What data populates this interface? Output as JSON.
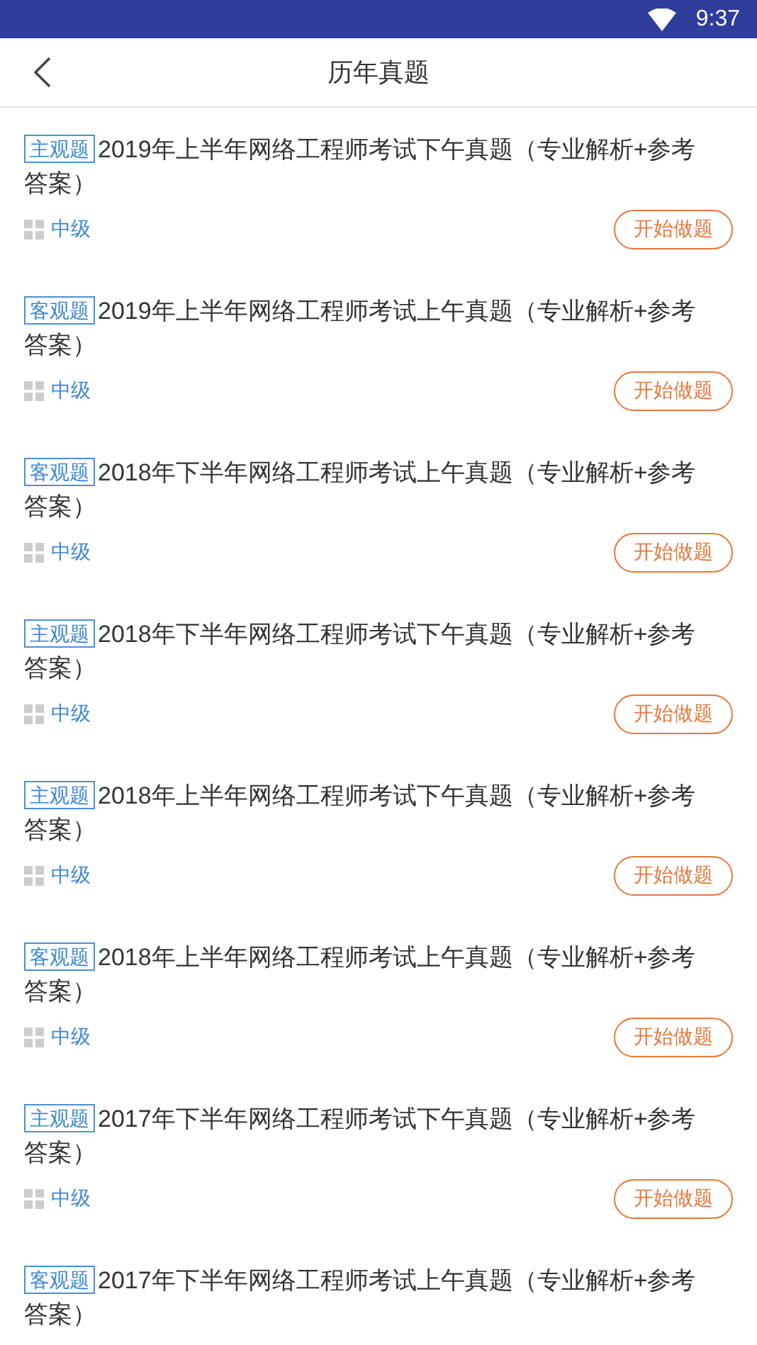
{
  "status_bar": {
    "time": "9:37"
  },
  "header": {
    "title": "历年真题"
  },
  "items": [
    {
      "tag": "主观题",
      "title": "2019年上半年网络工程师考试下午真题（专业解析+参考答案）",
      "level": "中级",
      "button": "开始做题"
    },
    {
      "tag": "客观题",
      "title": "2019年上半年网络工程师考试上午真题（专业解析+参考答案）",
      "level": "中级",
      "button": "开始做题"
    },
    {
      "tag": "客观题",
      "title": "2018年下半年网络工程师考试上午真题（专业解析+参考答案）",
      "level": "中级",
      "button": "开始做题"
    },
    {
      "tag": "主观题",
      "title": "2018年下半年网络工程师考试下午真题（专业解析+参考答案）",
      "level": "中级",
      "button": "开始做题"
    },
    {
      "tag": "主观题",
      "title": "2018年上半年网络工程师考试下午真题（专业解析+参考答案）",
      "level": "中级",
      "button": "开始做题"
    },
    {
      "tag": "客观题",
      "title": "2018年上半年网络工程师考试上午真题（专业解析+参考答案）",
      "level": "中级",
      "button": "开始做题"
    },
    {
      "tag": "主观题",
      "title": "2017年下半年网络工程师考试下午真题（专业解析+参考答案）",
      "level": "中级",
      "button": "开始做题"
    },
    {
      "tag": "客观题",
      "title": "2017年下半年网络工程师考试上午真题（专业解析+参考答案）"
    }
  ]
}
